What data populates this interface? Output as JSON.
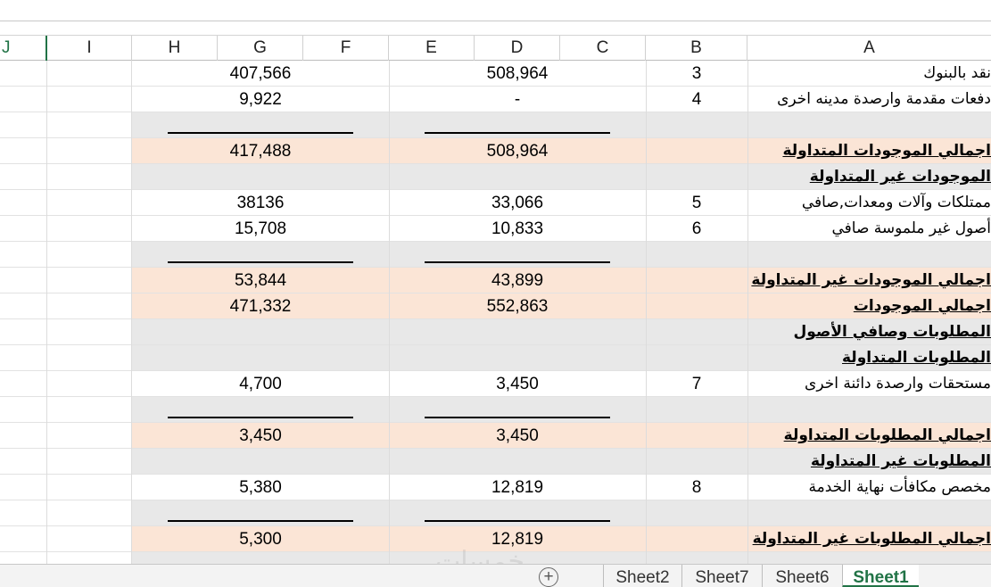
{
  "columns": [
    "J",
    "I",
    "H",
    "G",
    "F",
    "E",
    "D",
    "C",
    "B",
    "A"
  ],
  "rows": [
    {
      "style": "white",
      "g": "407,566",
      "d": "508,964",
      "b": "3",
      "label": "نقد بالبنوك",
      "bold": false,
      "underline": false
    },
    {
      "style": "white",
      "g": "9,922",
      "d": "-",
      "b": "4",
      "label": "دفعات مقدمة وارصدة مدينه اخرى",
      "bold": false,
      "underline": false
    },
    {
      "style": "gray",
      "g": "",
      "d": "",
      "b": "",
      "label": "",
      "bold": false,
      "underline": true
    },
    {
      "style": "peach",
      "g": "417,488",
      "d": "508,964",
      "b": "",
      "label": "اجمالي الموجودات المتداولة",
      "bold": true,
      "underline": false
    },
    {
      "style": "gray",
      "g": "",
      "d": "",
      "b": "",
      "label": "الموجودات غير المتداولة",
      "bold": true,
      "underline": false
    },
    {
      "style": "white",
      "g": "38136",
      "d": "33,066",
      "b": "5",
      "label": "ممتلكات وآلات ومعدات,صافي",
      "bold": false,
      "underline": false
    },
    {
      "style": "white",
      "g": "15,708",
      "d": "10,833",
      "b": "6",
      "label": "أصول غير ملموسة صافي",
      "bold": false,
      "underline": false
    },
    {
      "style": "gray",
      "g": "",
      "d": "",
      "b": "",
      "label": "",
      "bold": false,
      "underline": true
    },
    {
      "style": "peach",
      "g": "53,844",
      "d": "43,899",
      "b": "",
      "label": "اجمالي الموجودات غير المتداولة",
      "bold": true,
      "underline": false
    },
    {
      "style": "peach",
      "g": "471,332",
      "d": "552,863",
      "b": "",
      "label": "اجمالي الموجودات",
      "bold": true,
      "underline": false
    },
    {
      "style": "gray",
      "g": "",
      "d": "",
      "b": "",
      "label": "المطلوبات وصافي الأصول",
      "bold": true,
      "underline": false
    },
    {
      "style": "gray",
      "g": "",
      "d": "",
      "b": "",
      "label": "المطلوبات المتداولة",
      "bold": true,
      "underline": false
    },
    {
      "style": "white",
      "g": "4,700",
      "d": "3,450",
      "b": "7",
      "label": "مستحقات وارصدة دائنة اخرى",
      "bold": false,
      "underline": false
    },
    {
      "style": "gray",
      "g": "",
      "d": "",
      "b": "",
      "label": "",
      "bold": false,
      "underline": true
    },
    {
      "style": "peach",
      "g": "3,450",
      "d": "3,450",
      "b": "",
      "label": "اجمالي المطلوبات المتداولة",
      "bold": true,
      "underline": false
    },
    {
      "style": "gray",
      "g": "",
      "d": "",
      "b": "",
      "label": "المطلوبات غير المتداولة",
      "bold": true,
      "underline": false
    },
    {
      "style": "white",
      "g": "5,380",
      "d": "12,819",
      "b": "8",
      "label": "مخصص مكافأت نهاية الخدمة",
      "bold": false,
      "underline": false
    },
    {
      "style": "gray",
      "g": "",
      "d": "",
      "b": "",
      "label": "",
      "bold": false,
      "underline": true
    },
    {
      "style": "peach",
      "g": "5,300",
      "d": "12,819",
      "b": "",
      "label": "اجمالي المطلوبات غير المتداولة",
      "bold": true,
      "underline": false
    },
    {
      "style": "gray",
      "g": "",
      "d": "",
      "b": "",
      "label": "",
      "bold": false,
      "underline": false
    }
  ],
  "sheet_tabs": [
    {
      "label": "Sheet2",
      "active": false
    },
    {
      "label": "Sheet7",
      "active": false
    },
    {
      "label": "Sheet6",
      "active": false
    },
    {
      "label": "Sheet1",
      "active": true
    }
  ],
  "add_sheet_glyph": "+",
  "watermark": "خمسات",
  "colors": {
    "peach_band": "#fbe5d6",
    "gray_band": "#e8e8e8",
    "active_tab": "#217346"
  }
}
